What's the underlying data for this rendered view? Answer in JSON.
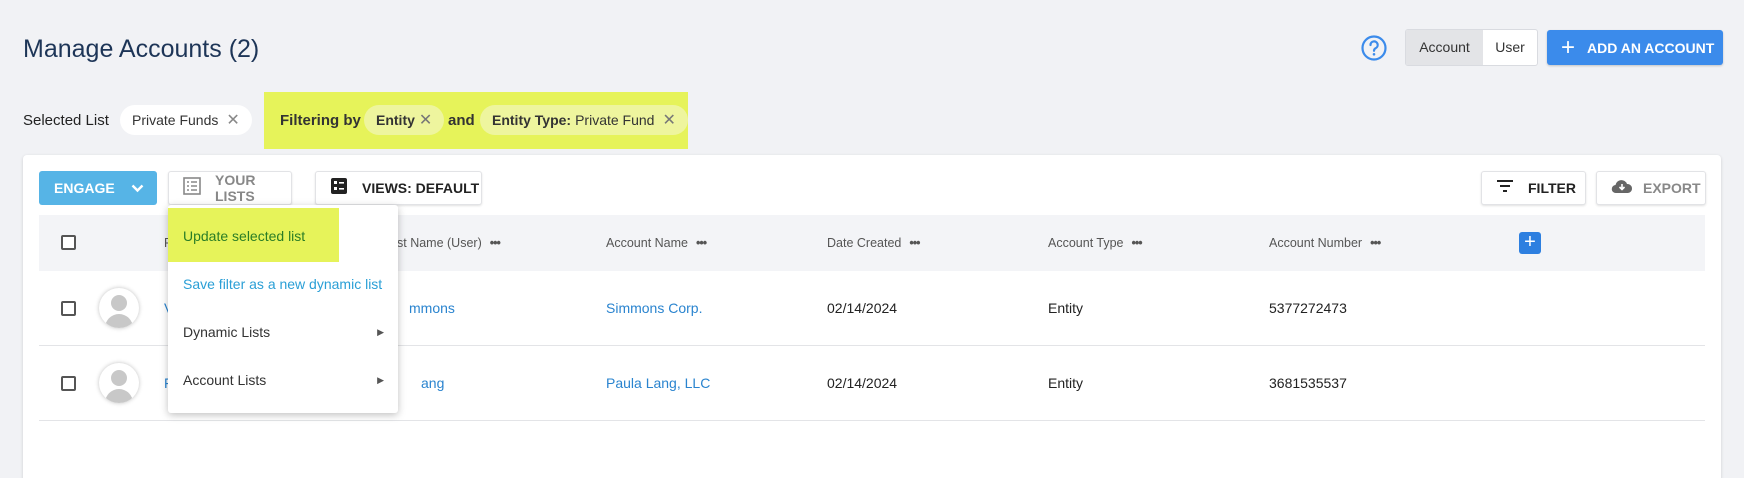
{
  "header": {
    "title": "Manage Accounts (2)",
    "toggle": {
      "account": "Account",
      "user": "User"
    },
    "add_button": "ADD AN ACCOUNT"
  },
  "selected_list": {
    "label": "Selected List",
    "chip": "Private Funds"
  },
  "filters": {
    "label": "Filtering by",
    "chip1": "Entity",
    "and_label": "and",
    "chip2_key": "Entity Type:",
    "chip2_value": "Private Fund"
  },
  "toolbar": {
    "engage": "ENGAGE",
    "your_lists": "YOUR LISTS",
    "views": "VIEWS: DEFAULT",
    "filter": "FILTER",
    "export": "EXPORT"
  },
  "table": {
    "columns": {
      "first_name_partial": "F",
      "last_name": "st Name (User)",
      "account_name": "Account Name",
      "date_created": "Date Created",
      "account_type": "Account Type",
      "account_number": "Account Number"
    },
    "rows": [
      {
        "first_partial": "V",
        "last": "mmons",
        "account_name": "Simmons Corp.",
        "date": "02/14/2024",
        "type": "Entity",
        "number": "5377272473"
      },
      {
        "first_partial": "F",
        "last": "ang",
        "account_name": "Paula Lang, LLC",
        "date": "02/14/2024",
        "type": "Entity",
        "number": "3681535537"
      }
    ]
  },
  "menu": {
    "update": "Update selected list",
    "save_dynamic": "Save filter as a new dynamic list",
    "dynamic_lists": "Dynamic Lists",
    "account_lists": "Account Lists"
  },
  "colors": {
    "primary": "#3b8beb",
    "engage": "#56b4e6",
    "highlight": "#e6f35a",
    "link": "#2a84cf"
  }
}
